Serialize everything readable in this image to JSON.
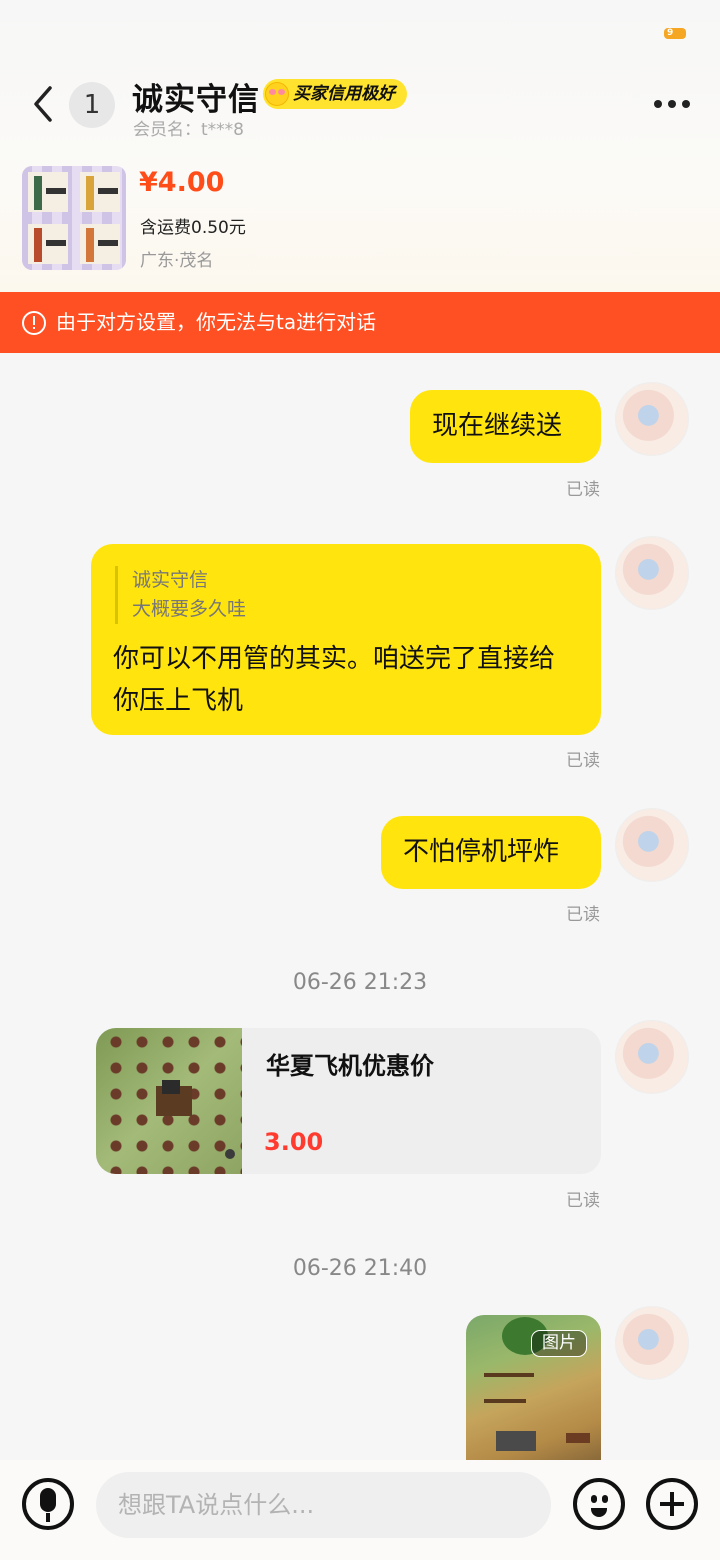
{
  "status_bar": {
    "badge": "9"
  },
  "header": {
    "unread_count": "1",
    "nickname": "诚实守信",
    "credit_badge": "买家信用极好",
    "member_name": "会员名：t***8"
  },
  "product": {
    "price": "¥4.00",
    "shipping": "含运费0.50元",
    "location": "广东·茂名"
  },
  "warning": {
    "text": "由于对方设置，你无法与ta进行对话"
  },
  "messages": [
    {
      "text": "现在继续送",
      "status": "已读"
    },
    {
      "quote_name": "诚实守信",
      "quote_text": "大概要多久哇",
      "text": "你可以不用管的其实。咱送完了直接给你压上飞机",
      "status": "已读"
    },
    {
      "text": "不怕停机坪炸",
      "status": "已读"
    },
    {
      "time": "06-26 21:23"
    },
    {
      "card_title": "华夏飞机优惠价",
      "card_price": "3.00",
      "status": "已读"
    },
    {
      "time": "06-26 21:40"
    },
    {
      "image_tag": "图片"
    }
  ],
  "input": {
    "placeholder": "想跟TA说点什么..."
  },
  "icons": [
    "back-icon",
    "more-icon",
    "warning-icon",
    "mic-icon",
    "emoji-icon",
    "plus-icon"
  ],
  "colors": {
    "accent_yellow": "#ffe40e",
    "warning_orange": "#ff5023",
    "price_red": "#ff4d1a"
  }
}
